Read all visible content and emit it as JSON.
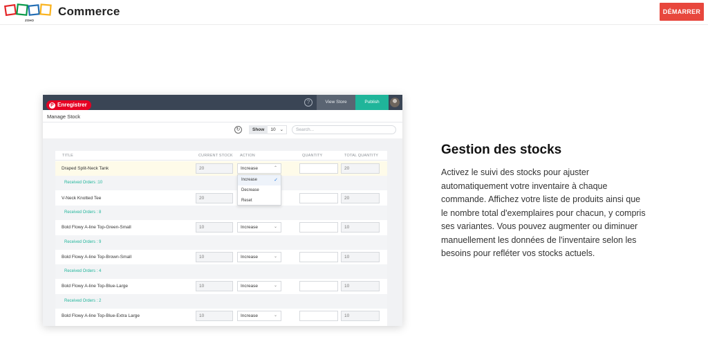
{
  "header": {
    "brand": "Commerce",
    "logo_text": "ZOHO",
    "cta_label": "DÉMARRER",
    "accent": "#e8473d"
  },
  "mock": {
    "pin_label": "Enregistrer",
    "help_icon": "?",
    "view_store": "View Store",
    "publish": "Publish",
    "page_title": "Manage Stock",
    "show_label": "Show",
    "show_value": "10",
    "search_placeholder": "Search...",
    "columns": [
      "TITLE",
      "CURRENT STOCK",
      "ACTION",
      "QUANTITY",
      "TOTAL QUANTITY"
    ],
    "rows": [
      {
        "title": "Draped Split-Neck Tank",
        "stock": "20",
        "action": "Increase",
        "total": "20",
        "received": "Received Orders :10"
      },
      {
        "title": "V-Neck Knotted Tee",
        "stock": "20",
        "action": "",
        "total": "20",
        "received": "Received Orders : 8"
      },
      {
        "title": "Bold Flowy A-line Top-Green-Small",
        "stock": "10",
        "action": "Increase",
        "total": "10",
        "received": "Received Orders : 9"
      },
      {
        "title": "Bold Flowy A-line Top-Brown-Small",
        "stock": "10",
        "action": "Increase",
        "total": "10",
        "received": "Received Orders : 4"
      },
      {
        "title": "Bold Flowy A-line Top-Blue-Large",
        "stock": "10",
        "action": "Increase",
        "total": "10",
        "received": "Received Orders : 2"
      },
      {
        "title": "Bold Flowy A-line Top-Blue-Extra Large",
        "stock": "10",
        "action": "Increase",
        "total": "10",
        "received": ""
      }
    ],
    "dropdown_options": [
      "Increase",
      "Decrease",
      "Reset"
    ],
    "teal": "#1fb59a"
  },
  "feature": {
    "title": "Gestion des stocks",
    "description": "Activez le suivi des stocks pour ajuster automatiquement votre inventaire à chaque commande. Affichez votre liste de produits ainsi que le nombre total d'exemplaires pour chacun, y compris ses variantes. Vous pouvez augmenter ou diminuer manuellement les données de l'inventaire selon les besoins pour refléter vos stocks actuels."
  }
}
